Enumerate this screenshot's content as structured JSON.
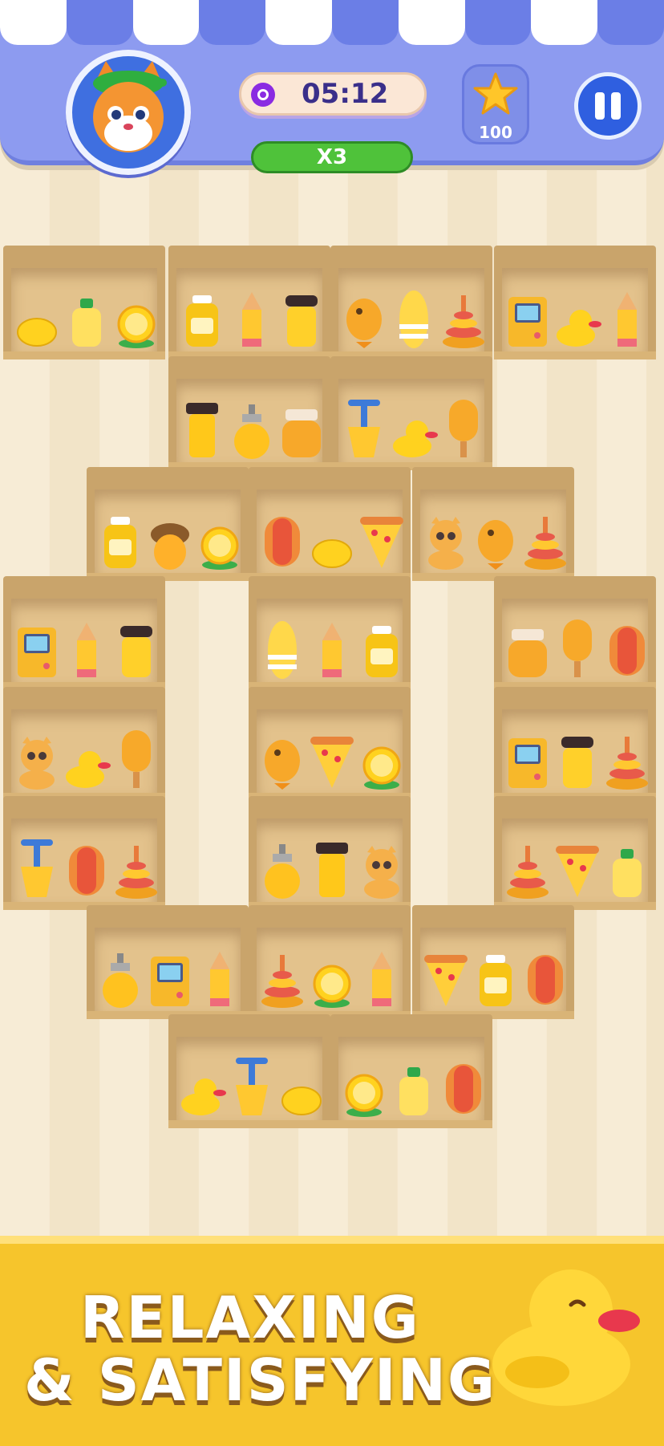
{
  "hud": {
    "timer": "05:12",
    "combo": "X3",
    "stars": "100",
    "avatar_icon": "cat-mascot-icon",
    "pause_icon": "pause-icon"
  },
  "colors": {
    "top_bar": "#8d9bf0",
    "combo_green": "#4fc23a",
    "pause_blue": "#2f5fe0",
    "footer_yellow": "#f6c52c",
    "shelf_wood": "#c9a46b"
  },
  "shelves": [
    {
      "items": [
        "lemon-icon",
        "juice-bottle-icon",
        "lemon-slice-icon"
      ]
    },
    {
      "items": [
        "mustard-jar-icon",
        "pencil-icon",
        "coffee-cup-icon"
      ]
    },
    {
      "items": [
        "fish-icon",
        "surfboard-icon",
        "ring-stacker-icon"
      ]
    },
    {
      "items": [
        "game-console-icon",
        "rubber-duck-icon",
        "pencil-icon"
      ]
    },
    {
      "items": [
        "travel-mug-icon",
        "honey-bottle-icon",
        "honey-jar-icon"
      ]
    },
    {
      "items": [
        "sand-shovel-icon",
        "rubber-duck-icon",
        "popsicle-icon"
      ]
    },
    {
      "items": [
        "mustard-jar-icon",
        "acorn-icon",
        "lemon-slice-icon"
      ]
    },
    {
      "items": [
        "hotdog-icon",
        "lemon-icon",
        "pizza-slice-icon"
      ]
    },
    {
      "items": [
        "cat-figure-icon",
        "fish-icon",
        "ring-stacker-icon"
      ]
    },
    {
      "items": [
        "game-console-icon",
        "pencil-icon",
        "coffee-cup-icon"
      ]
    },
    {
      "items": [
        "surfboard-icon",
        "pencil-icon",
        "mustard-jar-icon"
      ]
    },
    {
      "items": [
        "honey-jar-icon",
        "popsicle-icon",
        "hotdog-icon"
      ]
    },
    {
      "items": [
        "cat-figure-icon",
        "rubber-duck-icon",
        "popsicle-icon"
      ]
    },
    {
      "items": [
        "fish-icon",
        "pizza-slice-icon",
        "lemon-slice-icon"
      ]
    },
    {
      "items": [
        "game-console-icon",
        "coffee-cup-icon",
        "ring-stacker-icon"
      ]
    },
    {
      "items": [
        "sand-shovel-icon",
        "hotdog-icon",
        "ring-stacker-icon"
      ]
    },
    {
      "items": [
        "honey-bottle-icon",
        "travel-mug-icon",
        "cat-figure-icon"
      ]
    },
    {
      "items": [
        "ring-stacker-icon",
        "pizza-slice-icon",
        "juice-bottle-icon"
      ]
    },
    {
      "items": [
        "honey-bottle-icon",
        "game-console-icon",
        "pencil-icon"
      ]
    },
    {
      "items": [
        "ring-stacker-icon",
        "lemon-slice-icon",
        "pencil-icon"
      ]
    },
    {
      "items": [
        "pizza-slice-icon",
        "mustard-jar-icon",
        "hotdog-icon"
      ]
    },
    {
      "items": [
        "rubber-duck-icon",
        "sand-shovel-icon",
        "lemon-icon"
      ]
    },
    {
      "items": [
        "lemon-slice-icon",
        "juice-bottle-icon",
        "hotdog-icon"
      ]
    }
  ],
  "banner": {
    "line1": "RELAXING",
    "line2": "& SATISFYING",
    "mascot": "rubber-duck-icon"
  }
}
